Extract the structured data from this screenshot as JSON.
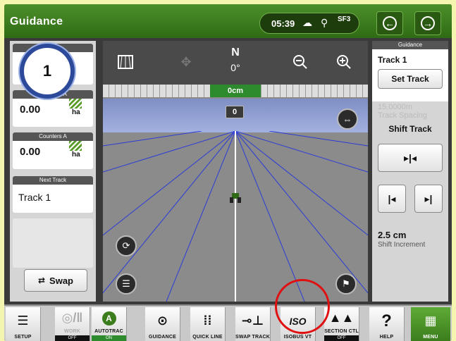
{
  "header": {
    "title": "Guidance",
    "time": "05:39",
    "status_tag": "SF3",
    "back_icon": "arrow-left-circle-icon",
    "forward_icon": "arrow-right-circle-icon"
  },
  "badge": {
    "number": "1"
  },
  "left_panel": {
    "cards": [
      {
        "header": "Counters A",
        "value": "0.00",
        "unit": "ha"
      },
      {
        "header": "Counters A",
        "value": "0.00",
        "unit": "ha"
      }
    ],
    "next_track": {
      "header": "Next Track",
      "value": "Track 1"
    },
    "swap_label": "Swap"
  },
  "center": {
    "heading_letter": "N",
    "heading_degrees": "0°",
    "offset": "0cm",
    "track_number": "0"
  },
  "right_panel": {
    "header": "Guidance",
    "track_name": "Track 1",
    "set_track_label": "Set Track",
    "track_spacing_value": "15.0000m",
    "track_spacing_label": "Track Spacing",
    "shift_track_label": "Shift Track",
    "shift_increment_value": "2.5 cm",
    "shift_increment_label": "Shift Increment"
  },
  "bottom_bar": {
    "tools": [
      {
        "label": "SETUP",
        "state": ""
      },
      {
        "label": "WORK",
        "state": "OFF"
      },
      {
        "label": "AUTOTRAC",
        "state": "ON"
      },
      {
        "label": "GUIDANCE",
        "state": ""
      },
      {
        "label": "QUICK LINE",
        "state": ""
      },
      {
        "label": "SWAP TRACK",
        "state": ""
      },
      {
        "label": "ISOBUS VT",
        "state": ""
      },
      {
        "label": "SECTION CTL",
        "state": "OFF"
      },
      {
        "label": "HELP",
        "state": ""
      },
      {
        "label": "MENU",
        "state": ""
      }
    ]
  },
  "colors": {
    "header_green": "#3b7d1c",
    "highlight_red": "#e01010",
    "badge_ring": "#2d4a9a"
  }
}
